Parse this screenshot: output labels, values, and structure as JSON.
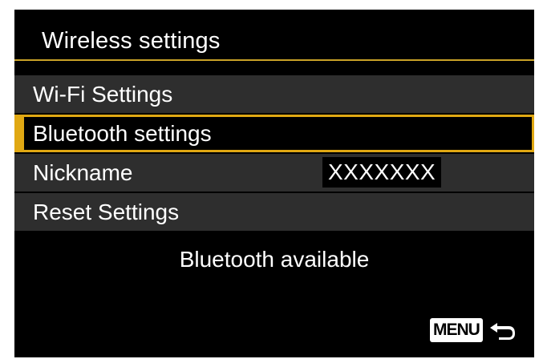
{
  "header": {
    "title": "Wireless settings"
  },
  "menu": {
    "items": [
      {
        "label": "Wi-Fi Settings",
        "selected": false
      },
      {
        "label": "Bluetooth settings",
        "selected": true
      },
      {
        "label": "Nickname",
        "value": "XXXXXXX",
        "selected": false
      },
      {
        "label": "Reset Settings",
        "selected": false
      }
    ]
  },
  "status": {
    "text": "Bluetooth available"
  },
  "footer": {
    "menu_key_label": "MENU",
    "return_icon": "return-arrow-icon"
  },
  "colors": {
    "background": "#000000",
    "item_background": "#2e2e2e",
    "selection_accent": "#e0a813",
    "header_rule": "#c9a227",
    "text": "#ffffff"
  }
}
